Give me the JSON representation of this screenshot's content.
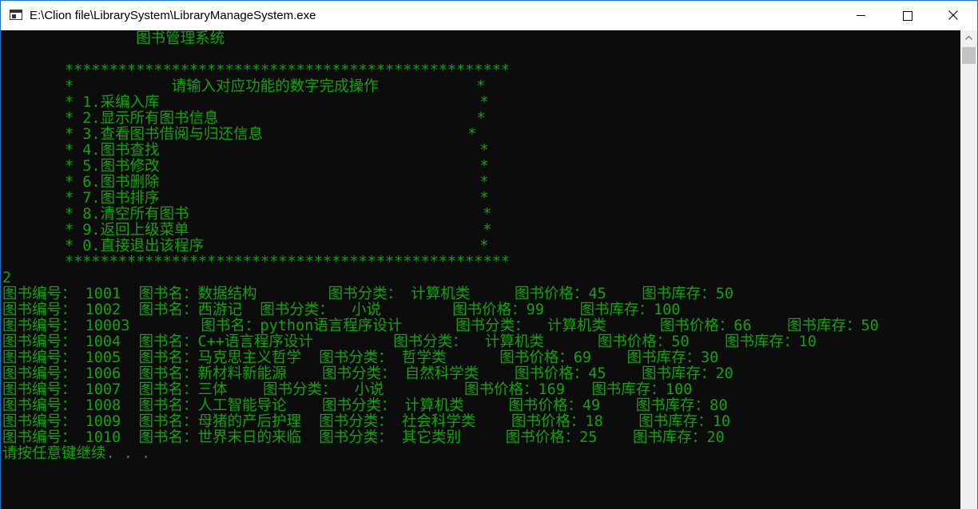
{
  "window": {
    "title": "E:\\Clion file\\LibrarySystem\\LibraryManageSystem.exe"
  },
  "icons": {
    "app": "console-window-icon",
    "minimize": "minimize-icon",
    "maximize": "maximize-icon",
    "close": "close-icon",
    "scroll_up": "scroll-up-arrow-icon"
  },
  "colors": {
    "console_background": "#0c0c0c",
    "console_text": "#13a10e",
    "title_bar": "#ffffff"
  },
  "console": {
    "lines": [
      "               图书管理系统",
      "",
      "       **************************************************",
      "       *           请输入对应功能的数字完成操作           *",
      "       * 1.采编入库                                    *",
      "       * 2.显示所有图书信息                             *",
      "       * 3.查看图书借阅与归还信息                       *",
      "       * 4.图书查找                                    *",
      "       * 5.图书修改                                    *",
      "       * 6.图书删除                                    *",
      "       * 7.图书排序                                    *",
      "       * 8.清空所有图书                                 *",
      "       * 9.返回上级菜单                                 *",
      "       * 0.直接退出该程序                               *",
      "       **************************************************",
      "2",
      "图书编号： 1001  图书名：数据结构        图书分类： 计算机类     图书价格：45    图书库存：50",
      "图书编号： 1002  图书名：西游记  图书分类：  小说        图书价格：99    图书库存：100",
      "图书编号： 10003        图书名：python语言程序设计      图书分类：  计算机类      图书价格：66    图书库存：50",
      "图书编号： 1004  图书名：C++语言程序设计         图书分类：  计算机类      图书价格：50    图书库存：10",
      "图书编号： 1005  图书名：马克思主义哲学  图书分类： 哲学类      图书价格：69    图书库存：30",
      "图书编号： 1006  图书名：新材料新能源    图书分类： 自然科学类    图书价格：45    图书库存：20",
      "图书编号： 1007  图书名：三体    图书分类：  小说         图书价格：169   图书库存：100",
      "图书编号： 1008  图书名：人工智能导论    图书分类： 计算机类     图书价格：49    图书库存：80",
      "图书编号： 1009  图书名：母猪的产后护理  图书分类： 社会科学类    图书价格：18    图书库存：10",
      "图书编号： 1010  图书名：世界末日的来临  图书分类： 其它类别     图书价格：25    图书库存：20",
      "请按任意键继续. . ."
    ]
  }
}
